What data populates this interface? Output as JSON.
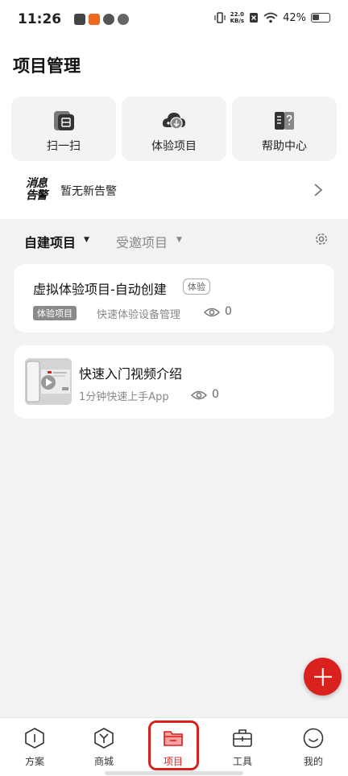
{
  "status_bar": {
    "time": "11:26",
    "net_speed_value": "22.0",
    "net_speed_unit": "KB/s",
    "battery": "42%"
  },
  "page": {
    "title": "项目管理"
  },
  "quick_actions": [
    {
      "label": "扫一扫",
      "icon": "scan-icon"
    },
    {
      "label": "体验项目",
      "icon": "cloud-download-icon"
    },
    {
      "label": "帮助中心",
      "icon": "help-book-icon"
    }
  ],
  "alert": {
    "logo_line1": "消息",
    "logo_line2": "告警",
    "text": "暂无新告警"
  },
  "tabs": {
    "own": "自建项目",
    "invited": "受邀项目"
  },
  "projects": [
    {
      "name": "虚拟体验项目-自动创建",
      "badge": "体验",
      "tag": "体验项目",
      "desc": "快速体验设备管理",
      "views": "0"
    }
  ],
  "video_card": {
    "title": "快速入门视频介绍",
    "subtitle": "1分钟快速上手App",
    "views": "0"
  },
  "bottom_nav": [
    {
      "label": "方案",
      "icon": "scheme-icon"
    },
    {
      "label": "商城",
      "icon": "mall-icon"
    },
    {
      "label": "项目",
      "icon": "folder-icon",
      "active": true
    },
    {
      "label": "工具",
      "icon": "toolbox-icon"
    },
    {
      "label": "我的",
      "icon": "profile-icon"
    }
  ],
  "colors": {
    "accent": "#d9211e",
    "background": "#f2f2f2",
    "card": "#ffffff"
  }
}
